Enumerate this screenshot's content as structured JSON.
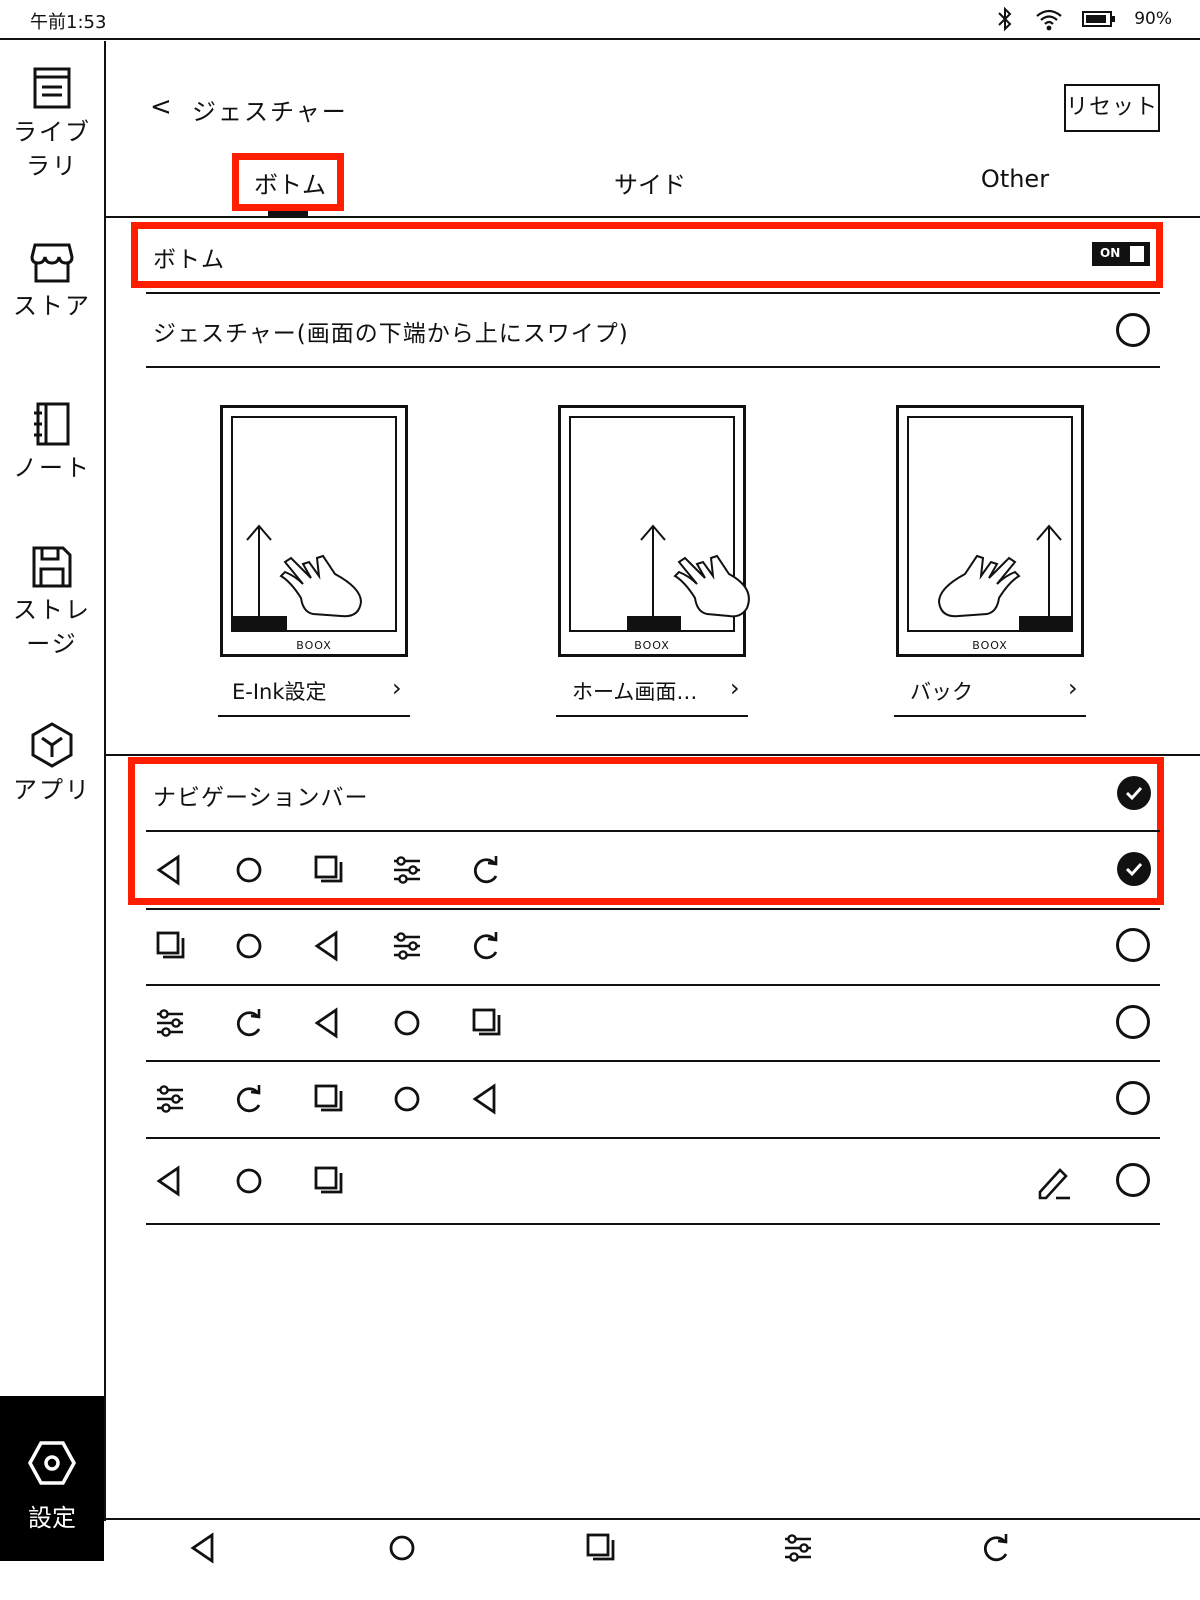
{
  "status": {
    "time": "午前1:53",
    "battery": "90%",
    "icons": [
      "bluetooth-icon",
      "wifi-icon",
      "battery-icon"
    ]
  },
  "sidebar": {
    "items": [
      {
        "label": "ライブラリ",
        "icon": "library-icon"
      },
      {
        "label": "ストア",
        "icon": "store-icon"
      },
      {
        "label": "ノート",
        "icon": "notebook-icon"
      },
      {
        "label": "ストレージ",
        "icon": "storage-icon"
      },
      {
        "label": "アプリ",
        "icon": "apps-icon"
      }
    ],
    "settings": {
      "label": "設定",
      "icon": "settings-icon"
    }
  },
  "header": {
    "back": "<",
    "title": "ジェスチャー",
    "reset": "リセット"
  },
  "tabs": [
    {
      "label": "ボトム",
      "active": true
    },
    {
      "label": "サイド",
      "active": false
    },
    {
      "label": "Other",
      "active": false
    }
  ],
  "bottom_section": {
    "label": "ボトム",
    "toggle": "ON",
    "gesture_option": "ジェスチャー(画面の下端から上にスワイプ)",
    "gesture_selected": false
  },
  "cards": [
    {
      "label": "E-Ink設定",
      "brand": "BOOX",
      "bar_position": "left"
    },
    {
      "label": "ホーム画面…",
      "brand": "BOOX",
      "bar_position": "center"
    },
    {
      "label": "バック",
      "brand": "BOOX",
      "bar_position": "right"
    }
  ],
  "navbar_section": {
    "label": "ナビゲーションバー",
    "selected": true,
    "layouts": [
      {
        "icons": [
          "back",
          "home",
          "recent",
          "adjust",
          "refresh"
        ],
        "selected": true
      },
      {
        "icons": [
          "recent",
          "home",
          "back",
          "adjust",
          "refresh"
        ],
        "selected": false
      },
      {
        "icons": [
          "adjust",
          "refresh",
          "back",
          "home",
          "recent"
        ],
        "selected": false
      },
      {
        "icons": [
          "adjust",
          "refresh",
          "recent",
          "home",
          "back"
        ],
        "selected": false
      },
      {
        "icons": [
          "back",
          "home",
          "recent"
        ],
        "selected": false,
        "editable": true
      }
    ]
  },
  "system_nav": [
    "back",
    "home",
    "recent",
    "adjust",
    "refresh"
  ],
  "colors": {
    "highlight": "#ff1e00",
    "ink": "#111111"
  }
}
